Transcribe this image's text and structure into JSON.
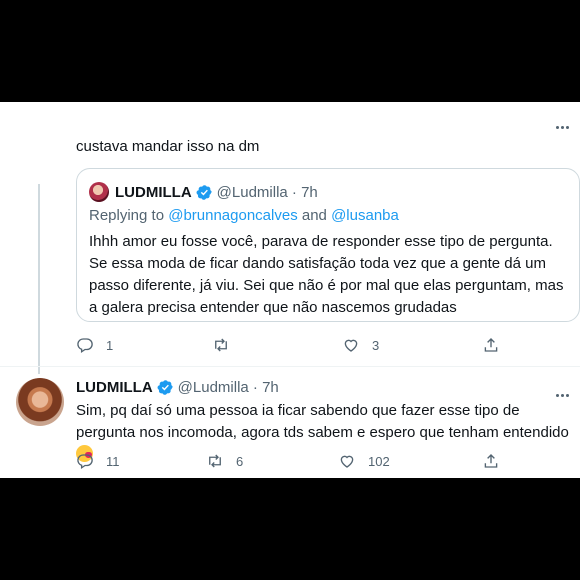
{
  "top_tweet": {
    "text": "custava mandar isso na dm",
    "quote": {
      "name": "LUDMILLA",
      "handle_time": "@Ludmilla · 7h",
      "replying_prefix": "Replying to ",
      "mention1": "@brunnagoncalves",
      "and": " and ",
      "mention2": "@lusanba",
      "body": "Ihhh amor eu fosse você, parava de responder esse tipo de pergunta. Se essa moda de ficar dando satisfação toda vez que a gente dá um passo diferente, já viu. Sei que não é por mal que elas perguntam, mas a galera precisa entender que não nascemos grudadas"
    },
    "actions": {
      "replies": "1",
      "retweets": "",
      "likes": "3"
    }
  },
  "second_tweet": {
    "name": "LUDMILLA",
    "handle_time": "@Ludmilla · 7h",
    "body": "Sim, pq daí só uma pessoa ia ficar sabendo que fazer esse tipo de pergunta nos incomoda, agora tds sabem e espero que tenham entendido",
    "actions": {
      "replies": "11",
      "retweets": "6",
      "likes": "102"
    }
  },
  "icons": [
    "more-icon",
    "verified-badge-icon",
    "reply-icon",
    "retweet-icon",
    "like-icon",
    "share-icon",
    "smiling-face-with-hearts-emoji"
  ],
  "colors": {
    "link": "#1d9bf0",
    "secondary": "#536471",
    "text": "#0f1419"
  }
}
